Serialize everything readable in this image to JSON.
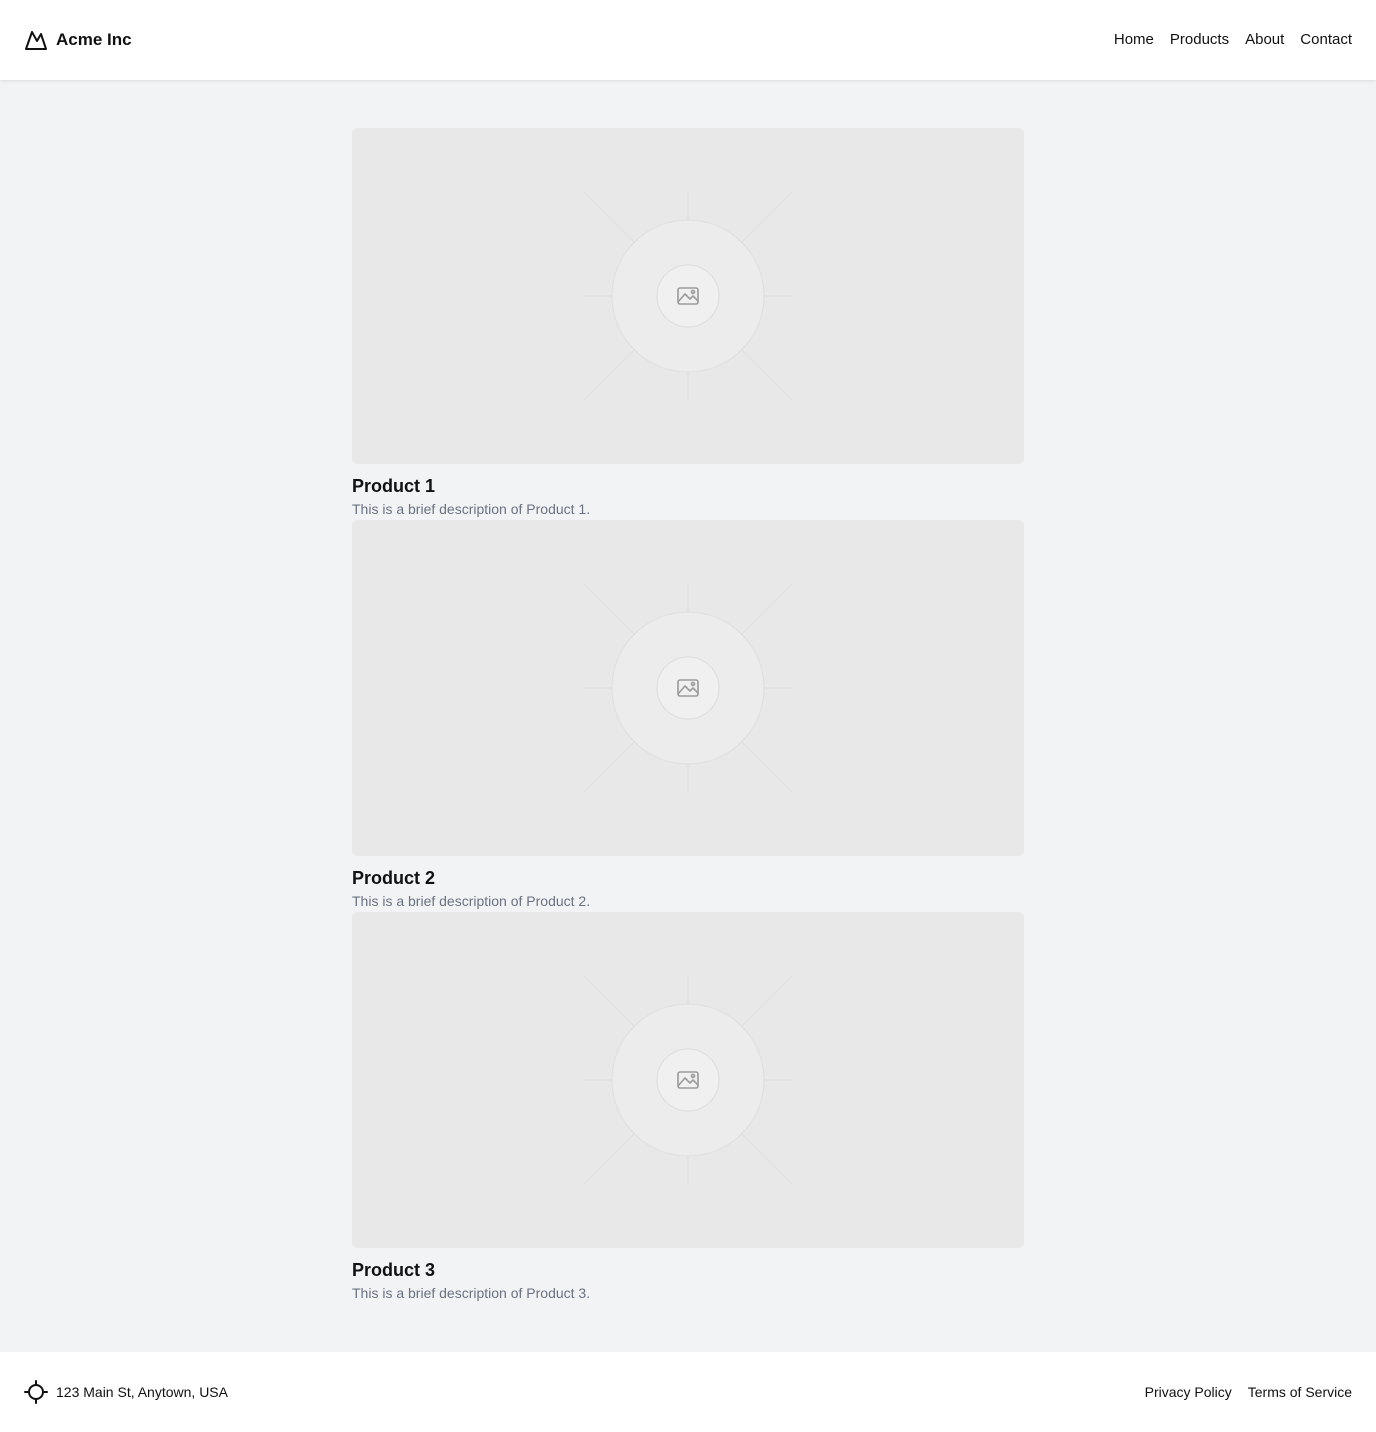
{
  "header": {
    "brand": {
      "name": "Acme Inc",
      "logo_icon": "mountain-icon"
    },
    "nav": [
      {
        "label": "Home"
      },
      {
        "label": "Products"
      },
      {
        "label": "About"
      },
      {
        "label": "Contact"
      }
    ]
  },
  "products": [
    {
      "title": "Product 1",
      "description": "This is a brief description of Product 1.",
      "image_icon": "image-placeholder-icon"
    },
    {
      "title": "Product 2",
      "description": "This is a brief description of Product 2.",
      "image_icon": "image-placeholder-icon"
    },
    {
      "title": "Product 3",
      "description": "This is a brief description of Product 3.",
      "image_icon": "image-placeholder-icon"
    }
  ],
  "footer": {
    "address": "123 Main St, Anytown, USA",
    "address_icon": "crosshair-icon",
    "links": [
      {
        "label": "Privacy Policy"
      },
      {
        "label": "Terms of Service"
      }
    ]
  },
  "colors": {
    "page_background": "#f2f3f5",
    "surface": "#ffffff",
    "image_placeholder": "#e8e8e8",
    "text_primary": "#111111",
    "text_muted": "#6b7280"
  }
}
